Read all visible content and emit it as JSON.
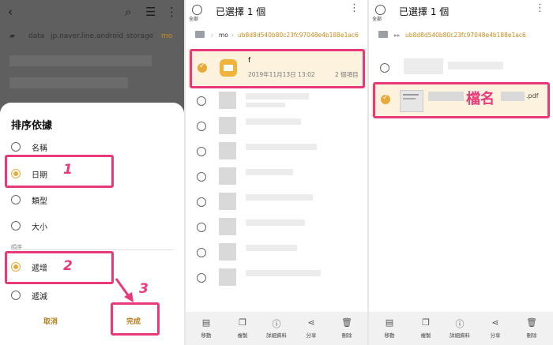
{
  "panel1": {
    "breadcrumb": [
      "data",
      "jp.naver.line.android",
      "storage",
      "mo"
    ],
    "sort_dialog": {
      "title": "排序依據",
      "options": [
        {
          "label": "名稱",
          "selected": false
        },
        {
          "label": "日期",
          "selected": true
        },
        {
          "label": "類型",
          "selected": false
        },
        {
          "label": "大小",
          "selected": false
        }
      ],
      "order_section": "順序",
      "order_options": [
        {
          "label": "遞增",
          "selected": true
        },
        {
          "label": "遞減",
          "selected": false
        }
      ],
      "cancel_label": "取消",
      "done_label": "完成"
    },
    "step_numbers": [
      "1",
      "2",
      "3"
    ]
  },
  "panel2": {
    "header": {
      "select_all_label": "全部",
      "title": "已選擇 1 個"
    },
    "breadcrumb": {
      "parent": "mo",
      "current": "ub8d8d540b80c23fc97048e4b188e1ac6"
    },
    "selected_folder": {
      "name": "f",
      "date": "2019年11月13日 13:02",
      "count": "2 個項目"
    },
    "bottom_bar": [
      "移動",
      "複製",
      "詳細資料",
      "分享",
      "刪除"
    ]
  },
  "panel3": {
    "header": {
      "select_all_label": "全部",
      "title": "已選擇 1 個"
    },
    "breadcrumb": {
      "current": "ub8d8d540b80c23fc97048e4b188e1ac6"
    },
    "selected_file": {
      "extension": ".pdf",
      "annotation": "檔名"
    },
    "bottom_bar": [
      "移動",
      "複製",
      "詳細資料",
      "分享",
      "刪除"
    ]
  },
  "colors": {
    "accent": "#e9a93a",
    "highlight": "#e8397a",
    "folder": "#f0b33b"
  },
  "icons": {
    "bottom_bar": [
      "move-icon",
      "copy-icon",
      "info-icon",
      "share-icon",
      "delete-icon"
    ]
  }
}
